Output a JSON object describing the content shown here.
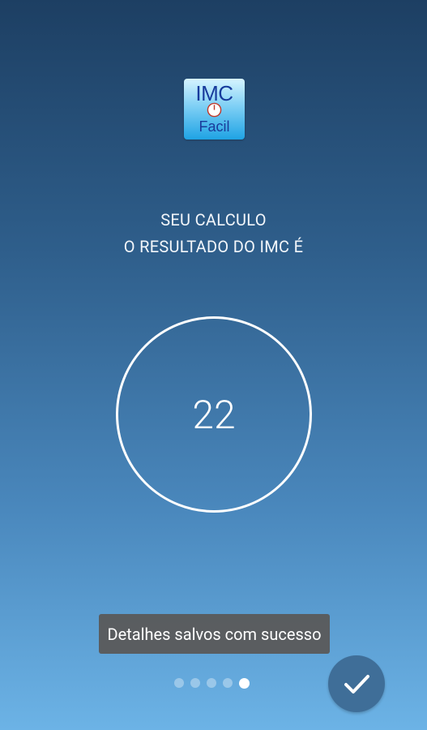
{
  "app": {
    "logo_text_top": "IMC",
    "logo_text_bottom": "Facil"
  },
  "screen": {
    "heading_line1": "SEU CALCULO",
    "heading_line2": "O RESULTADO DO IMC É",
    "result_value": "22"
  },
  "toast": {
    "message": "Detalhes salvos com sucesso"
  },
  "pager": {
    "total_pages": 5,
    "current_page": 5
  },
  "actions": {
    "done_icon": "check-icon"
  },
  "colors": {
    "gradient_top": "#1d3f63",
    "gradient_bottom": "#6cb3e6",
    "toast_background": "#5a5a5a",
    "done_button": "#3f6e98",
    "logo_text": "#173b9c"
  }
}
